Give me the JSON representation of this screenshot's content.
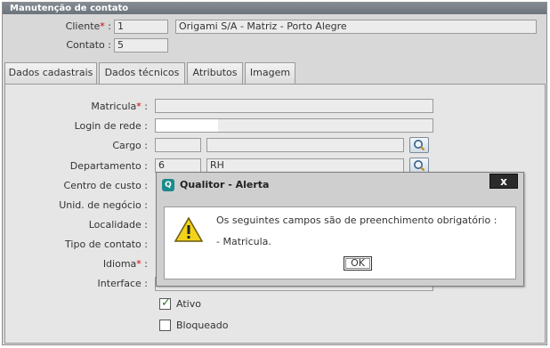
{
  "window": {
    "title": "Manutenção de contato"
  },
  "header": {
    "cliente_label": "Cliente",
    "cliente_required": "*",
    "cliente_colon": ":",
    "cliente_code": "1",
    "cliente_name": "Origami S/A - Matriz - Porto Alegre",
    "contato_label": "Contato :",
    "contato_value": "5"
  },
  "tabs": [
    "Dados cadastrais",
    "Dados técnicos",
    "Atributos",
    "Imagem"
  ],
  "active_tab": "Dados técnicos",
  "form": {
    "matricula_label": "Matricula",
    "matricula_required": "*",
    "login_label": "Login de rede :",
    "cargo_label": "Cargo :",
    "departamento_label": "Departamento :",
    "departamento_code": "6",
    "departamento_name": "RH",
    "centro_label": "Centro de custo :",
    "unid_label": "Unid. de negócio :",
    "localidade_label": "Localidade :",
    "tipo_label": "Tipo de contato :",
    "idioma_label": "Idioma",
    "idioma_required": "*",
    "interface_label": "Interface :",
    "colon": ":",
    "ativo_label": "Ativo",
    "ativo_checked": true,
    "bloqueado_label": "Bloqueado",
    "bloqueado_checked": false
  },
  "dialog": {
    "title": "Qualitor - Alerta",
    "close": "x",
    "message": "Os seguintes campos são de preenchimento obrigatório :",
    "item": "- Matricula.",
    "ok": "OK"
  },
  "colors": {
    "titlebar": "#6c737b",
    "required": "#cc0000",
    "dialog_close": "#2a2a2a",
    "warning": "#f2d21b"
  }
}
